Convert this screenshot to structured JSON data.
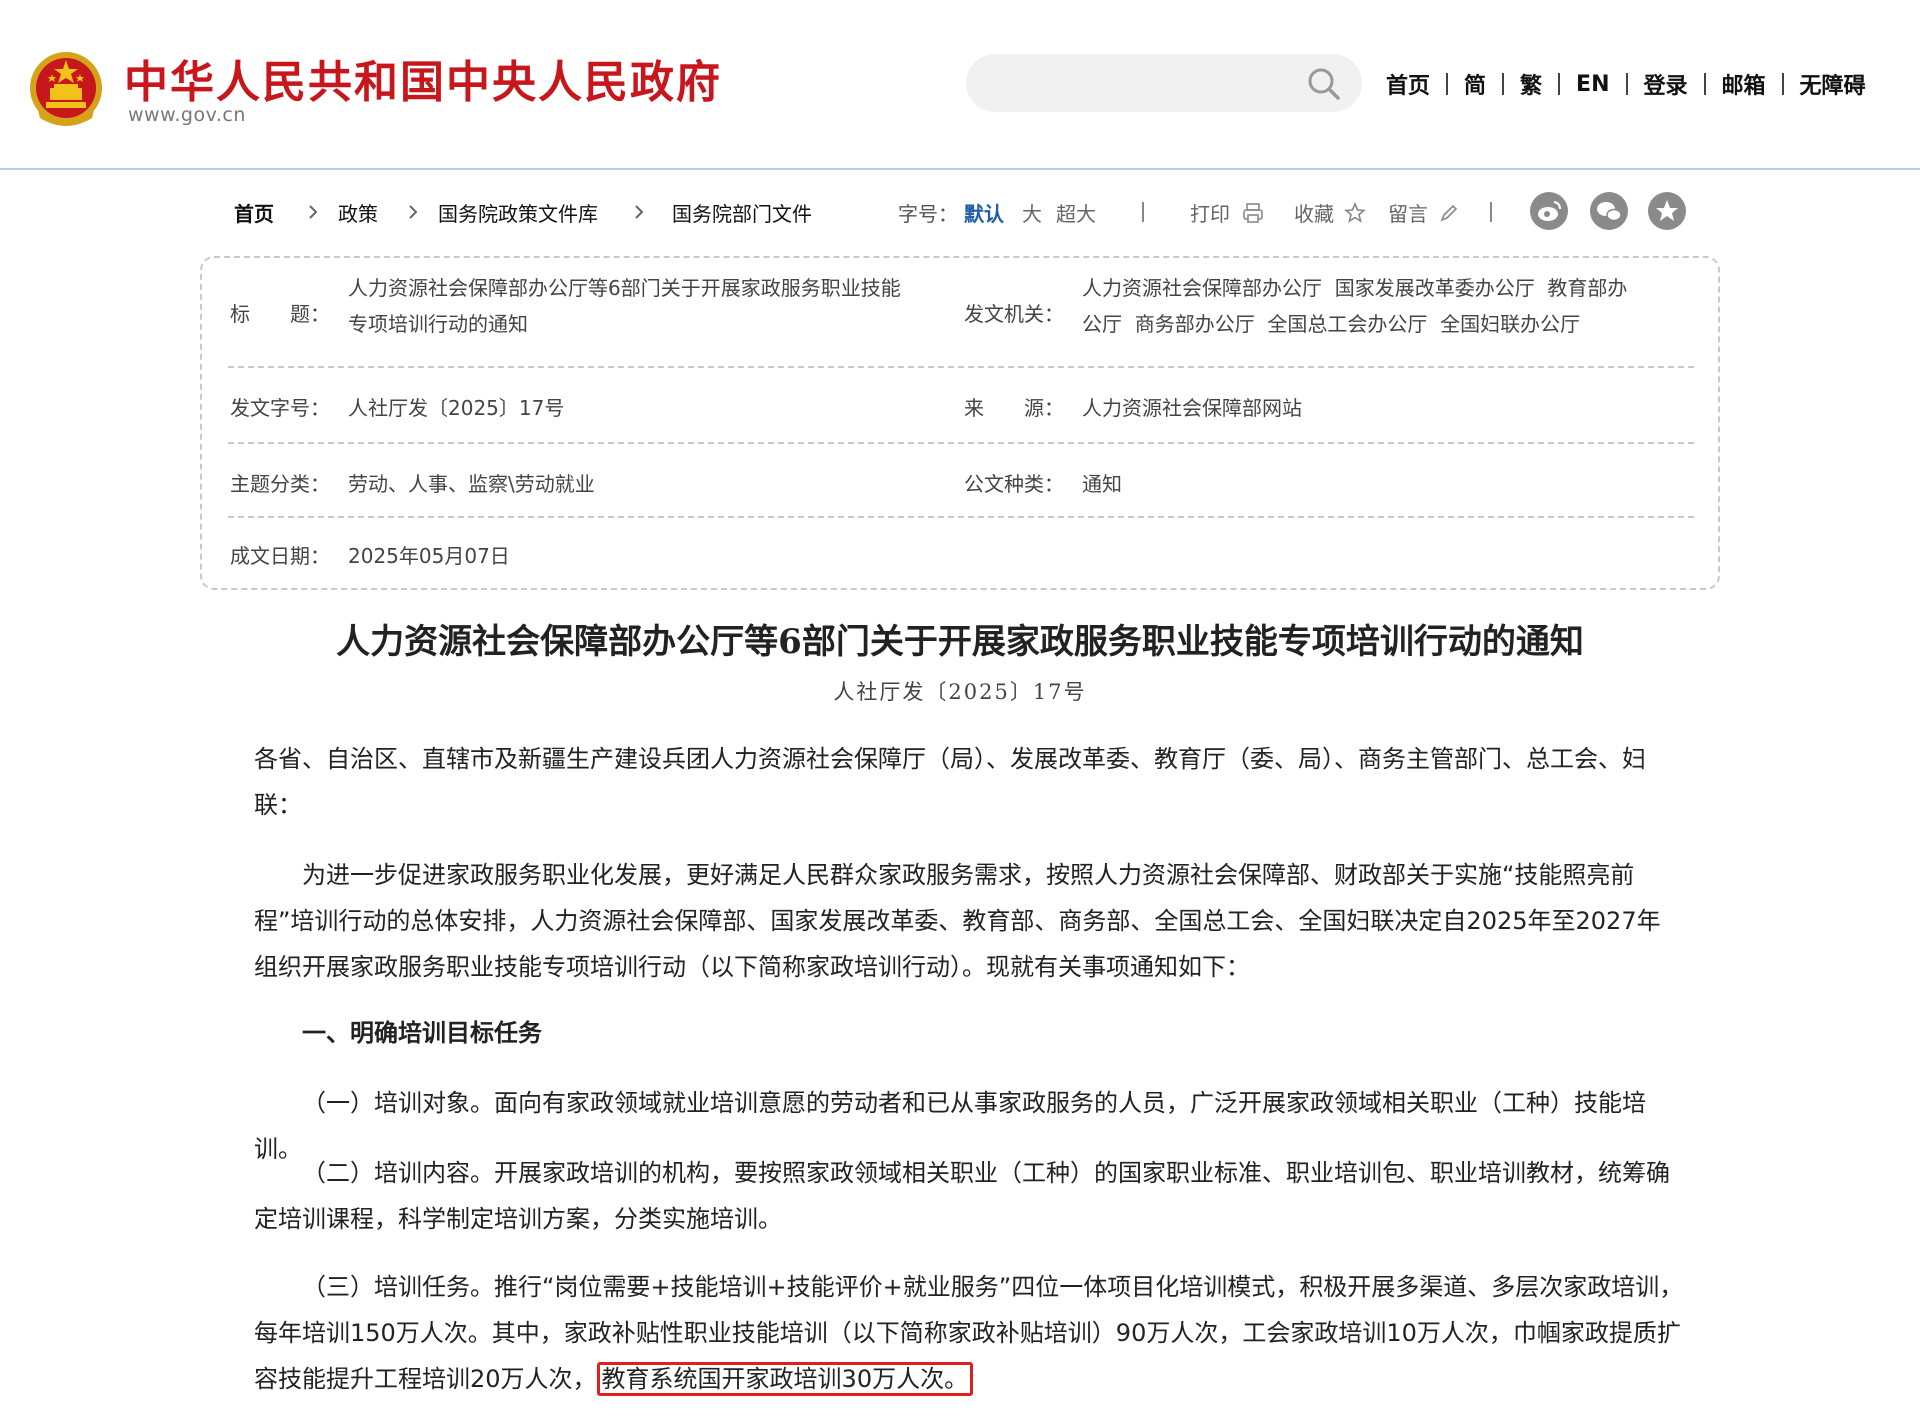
{
  "header": {
    "site_name": "中华人民共和国中央人民政府",
    "site_url": "www.gov.cn",
    "search_placeholder": "",
    "nav": [
      "首页",
      "简",
      "繁",
      "EN",
      "登录",
      "邮箱",
      "无障碍"
    ]
  },
  "breadcrumb": [
    "首页",
    "政策",
    "国务院政策文件库",
    "国务院部门文件"
  ],
  "toolbar": {
    "font_label": "字号：",
    "font_default": "默认",
    "font_large": "大",
    "font_xlarge": "超大",
    "print": "打印",
    "favorite": "收藏",
    "comment": "留言",
    "share_icons": [
      "weibo-icon",
      "wechat-icon",
      "star-share-icon"
    ]
  },
  "meta": {
    "title_label": "标　　题：",
    "title_line1": "人力资源社会保障部办公厅等6部门关于开展家政服务职业技能",
    "title_line2": "专项培训行动的通知",
    "issuer_label": "发文机关：",
    "issuer_line1": "人力资源社会保障部办公厅  国家发展改革委办公厅  教育部办",
    "issuer_line2": "公厅  商务部办公厅  全国总工会办公厅  全国妇联办公厅",
    "doc_no_label": "发文字号：",
    "doc_no": "人社厅发〔2025〕17号",
    "source_label": "来　　源：",
    "source": "人力资源社会保障部网站",
    "category_label": "主题分类：",
    "category": "劳动、人事、监察\\劳动就业",
    "doc_type_label": "公文种类：",
    "doc_type": "通知",
    "date_label": "成文日期：",
    "date": "2025年05月07日"
  },
  "document": {
    "title": "人力资源社会保障部办公厅等6部门关于开展家政服务职业技能专项培训行动的通知",
    "number": "人社厅发〔2025〕17号",
    "salutation": "各省、自治区、直辖市及新疆生产建设兵团人力资源社会保障厅（局）、发展改革委、教育厅（委、局）、商务主管部门、总工会、妇联：",
    "intro": "为进一步促进家政服务职业化发展，更好满足人民群众家政服务需求，按照人力资源社会保障部、财政部关于实施“技能照亮前程”培训行动的总体安排，人力资源社会保障部、国家发展改革委、教育部、商务部、全国总工会、全国妇联决定自2025年至2027年组织开展家政服务职业技能专项培训行动（以下简称家政培训行动）。现就有关事项通知如下：",
    "section1_heading": "一、明确培训目标任务",
    "item1": "（一）培训对象。面向有家政领域就业培训意愿的劳动者和已从事家政服务的人员，广泛开展家政领域相关职业（工种）技能培训。",
    "item2": "（二）培训内容。开展家政培训的机构，要按照家政领域相关职业（工种）的国家职业标准、职业培训包、职业培训教材，统筹确定培训课程，科学制定培训方案，分类实施培训。",
    "item3_main": "（三）培训任务。推行“岗位需要+技能培训+技能评价+就业服务”四位一体项目化培训模式，积极开展多渠道、多层次家政培训，每年培训150万人次。其中，家政补贴性职业技能培训（以下简称家政补贴培训）90万人次，工会家政培训10万人次，巾帼家政提质扩容技能提升工程培训20万人次，",
    "item3_highlight": "教育系统国开家政培训30万人次。"
  }
}
